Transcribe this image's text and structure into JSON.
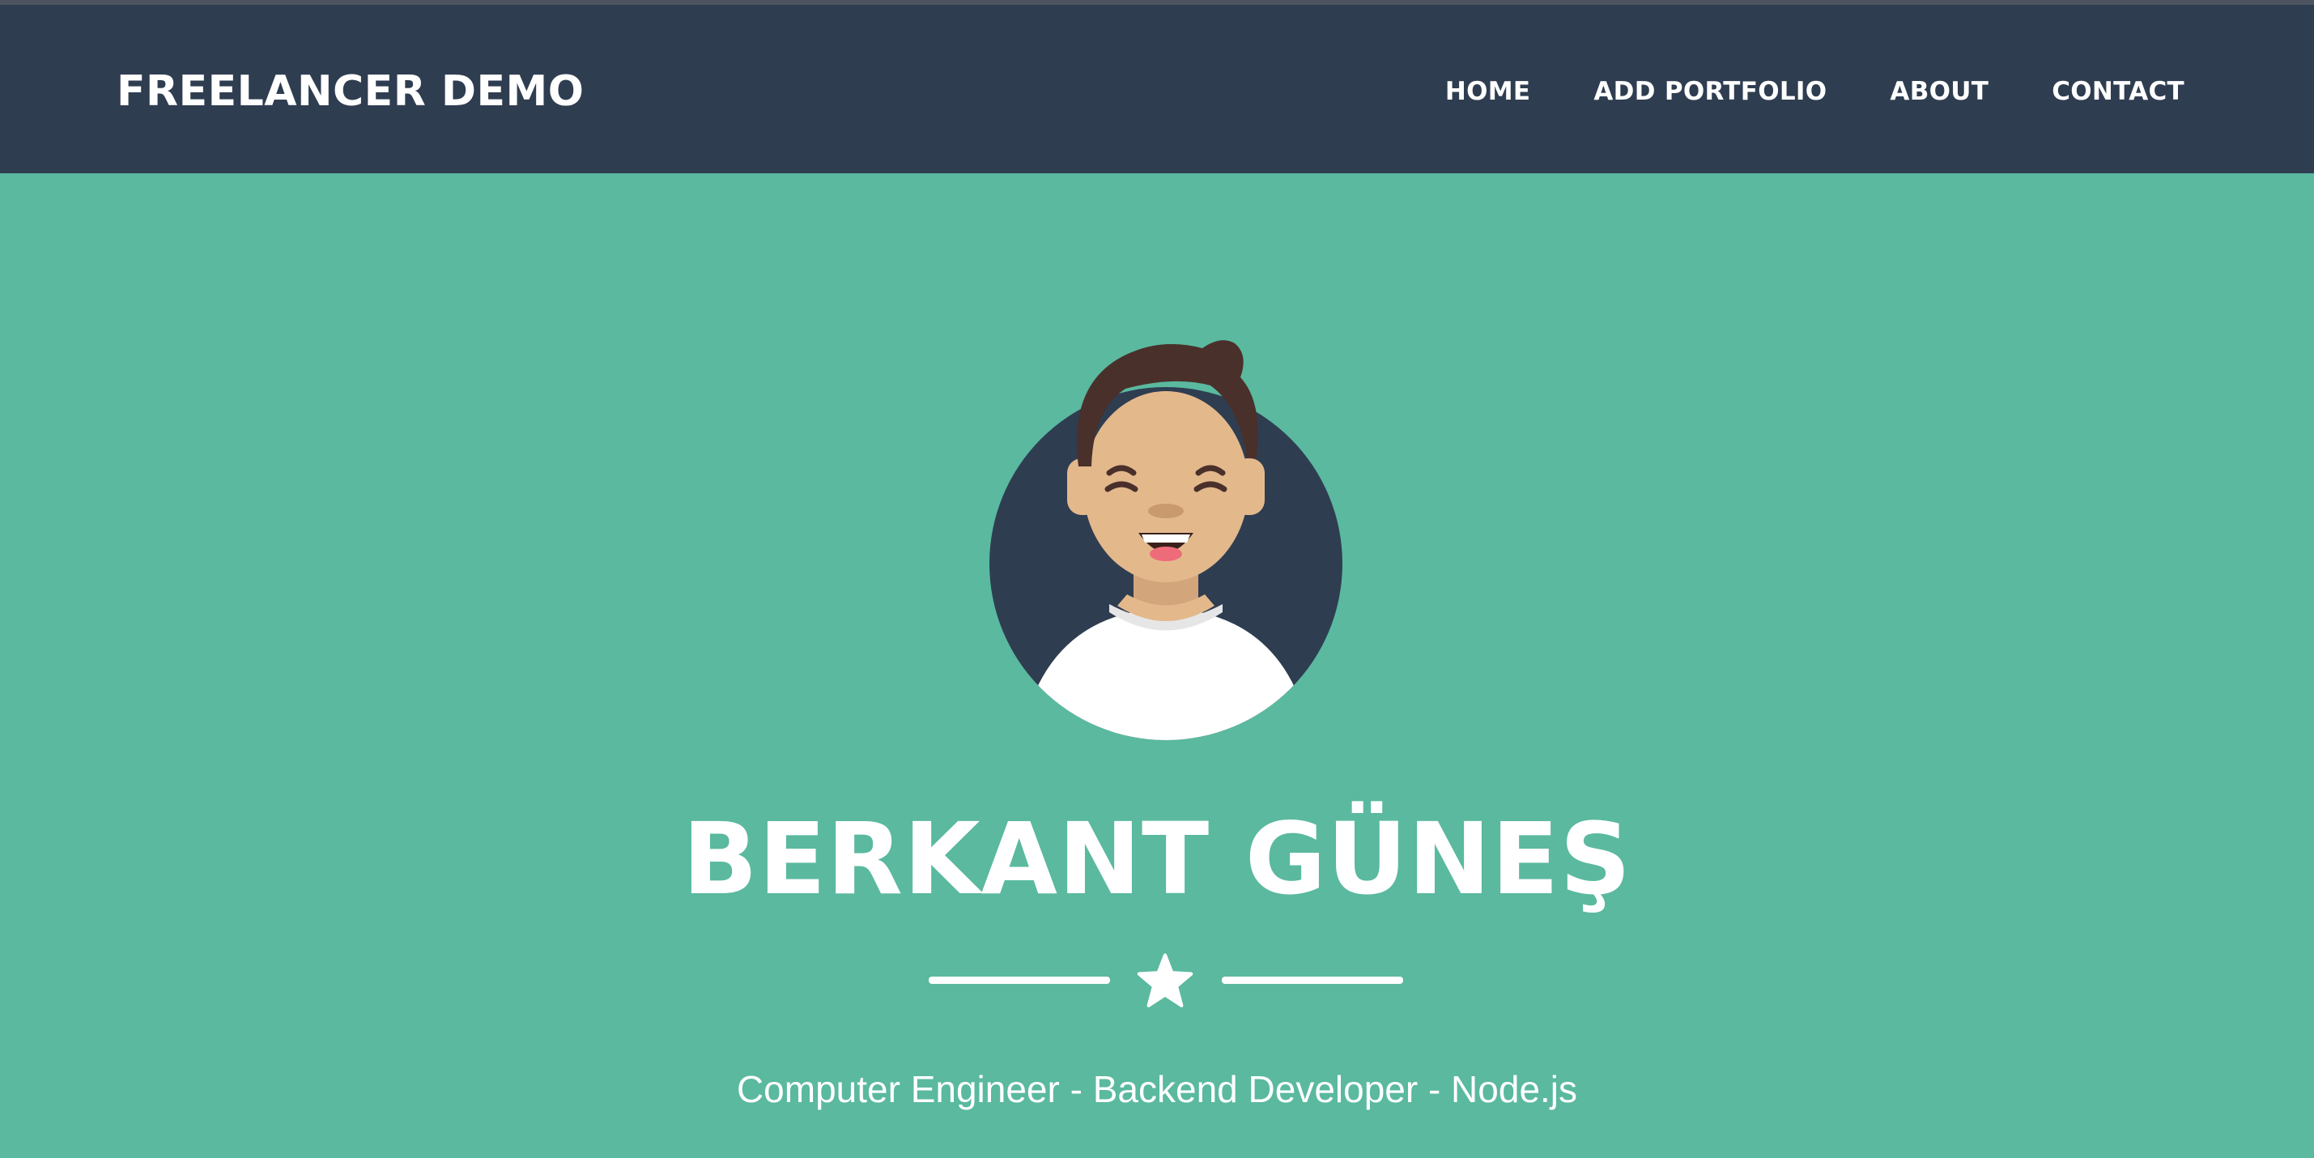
{
  "navbar": {
    "brand": "FREELANCER DEMO",
    "links": [
      {
        "label": "HOME"
      },
      {
        "label": "ADD PORTFOLIO"
      },
      {
        "label": "ABOUT"
      },
      {
        "label": "CONTACT"
      }
    ]
  },
  "hero": {
    "name": "BERKANT GÜNEŞ",
    "divider_icon": "star-icon",
    "subtitle": "Computer Engineer - Backend Developer - Node.js",
    "avatar_icon": "avatar-illustration"
  },
  "colors": {
    "navbar_bg": "#2f3d51",
    "hero_bg": "#5ab99f",
    "text": "#ffffff",
    "avatar_circle": "#2f3d51",
    "skin": "#e3b98c",
    "hair": "#4a302b",
    "shirt": "#ffffff"
  }
}
